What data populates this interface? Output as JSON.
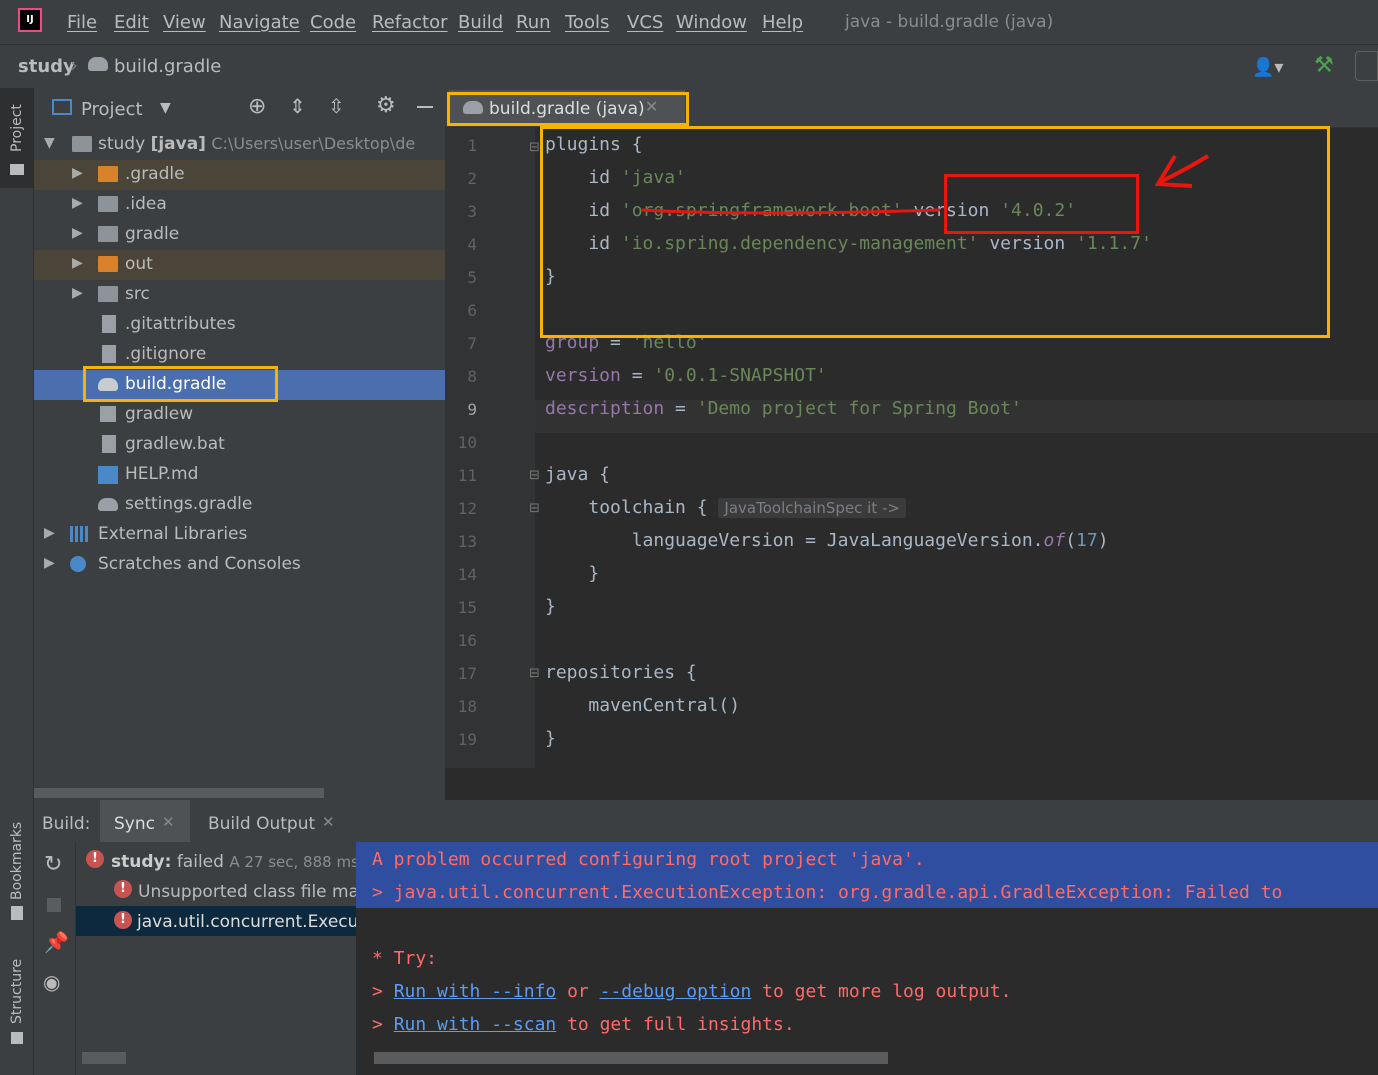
{
  "app": {
    "window_title": "java - build.gradle (java)",
    "logo_text": "IJ"
  },
  "menu": [
    "File",
    "Edit",
    "View",
    "Navigate",
    "Code",
    "Refactor",
    "Build",
    "Run",
    "Tools",
    "VCS",
    "Window",
    "Help"
  ],
  "breadcrumb": {
    "project": "study",
    "file": "build.gradle"
  },
  "left_stripe": {
    "project_label": "Project",
    "bookmarks_label": "Bookmarks",
    "structure_label": "Structure"
  },
  "project_panel": {
    "title": "Project",
    "root": {
      "name": "study",
      "module": "[java]",
      "path": "C:\\Users\\user\\Desktop\\de"
    },
    "items": [
      {
        "label": ".gradle",
        "type": "folder-excluded"
      },
      {
        "label": ".idea",
        "type": "folder"
      },
      {
        "label": "gradle",
        "type": "folder"
      },
      {
        "label": "out",
        "type": "folder-excluded"
      },
      {
        "label": "src",
        "type": "folder"
      },
      {
        "label": ".gitattributes",
        "type": "file"
      },
      {
        "label": ".gitignore",
        "type": "file"
      },
      {
        "label": "build.gradle",
        "type": "gradle-file",
        "selected": true
      },
      {
        "label": "gradlew",
        "type": "file"
      },
      {
        "label": "gradlew.bat",
        "type": "file"
      },
      {
        "label": "HELP.md",
        "type": "md-file"
      },
      {
        "label": "settings.gradle",
        "type": "gradle-file"
      }
    ],
    "external_libraries": "External Libraries",
    "scratches": "Scratches and Consoles"
  },
  "editor": {
    "tab_label": "build.gradle (java)",
    "lines": [
      "1",
      "2",
      "3",
      "4",
      "5",
      "6",
      "7",
      "8",
      "9",
      "10",
      "11",
      "12",
      "13",
      "14",
      "15",
      "16",
      "17",
      "18",
      "19"
    ],
    "code": {
      "l1": "plugins {",
      "l2_id": "id ",
      "l2_str": "'java'",
      "l3_id": "id ",
      "l3_str": "'org.springframework.boot'",
      "l3_version": " version ",
      "l3_ver": "'4.0.2'",
      "l4_id": "id ",
      "l4_str": "'io.spring.dependency-management'",
      "l4_version": " version ",
      "l4_ver": "'1.1.7'",
      "l5": "}",
      "l7_prop": "group",
      "l7_eq": " = ",
      "l7_str": "'hello'",
      "l8_prop": "version",
      "l8_eq": " = ",
      "l8_str": "'0.0.1-SNAPSHOT'",
      "l9_prop": "description",
      "l9_eq": " = ",
      "l9_str": "'Demo project for Spring Boot'",
      "l11": "java {",
      "l12": "toolchain {",
      "l12_hint": "JavaToolchainSpec it ->",
      "l13_a": "languageVersion = JavaLanguageVersion.",
      "l13_fn": "of",
      "l13_p1": "(",
      "l13_num": "17",
      "l13_p2": ")",
      "l14": "}",
      "l15": "}",
      "l17": "repositories {",
      "l18": "mavenCentral()",
      "l19": "}"
    }
  },
  "build": {
    "label": "Build:",
    "tabs": [
      "Sync",
      "Build Output"
    ],
    "tree": {
      "root_name": "study:",
      "root_status": "failed",
      "root_meta": "A 27 sec, 888 ms",
      "child1": "Unsupported class file maj",
      "child2": "java.util.concurrent.Executic"
    },
    "console": {
      "line1": "A problem occurred configuring root project 'java'.",
      "line2": "> java.util.concurrent.ExecutionException: org.gradle.api.GradleException: Failed to",
      "line3": "* Try:",
      "line4_pre": "> ",
      "line4_link1": "Run with --info",
      "line4_mid": " or ",
      "line4_link2": "--debug option",
      "line4_post": " to get more log output.",
      "line5_pre": "> ",
      "line5_link": "Run with --scan",
      "line5_post": " to get full insights."
    }
  },
  "colors": {
    "highlight_box": "#f5b400",
    "annotation_red": "#e8160f",
    "selection": "#4b6eaf",
    "error": "#ff6b68"
  }
}
